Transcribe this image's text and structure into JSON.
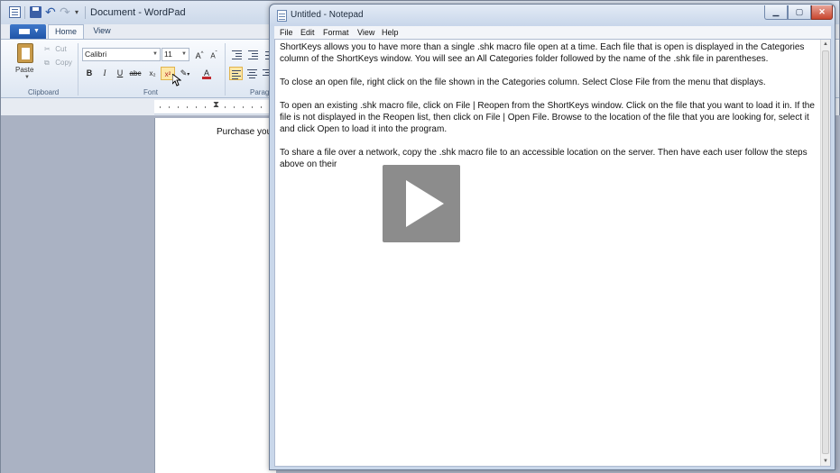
{
  "wordpad": {
    "title": "Document - WordPad",
    "tabs": [
      {
        "label": "Home"
      },
      {
        "label": "View"
      }
    ],
    "clipboard": {
      "paste": "Paste",
      "cut": "Cut",
      "copy": "Copy",
      "group_label": "Clipboard"
    },
    "font": {
      "name": "Calibri",
      "size": "11",
      "group_label": "Font",
      "bold": "B",
      "italic": "I",
      "underline": "U",
      "strike": "abc",
      "subscript": "x₂",
      "superscript": "x²"
    },
    "paragraph": {
      "group_label": "Parag"
    },
    "document_text": "Purchase you"
  },
  "notepad": {
    "title": "Untitled - Notepad",
    "menu": [
      {
        "label": "File"
      },
      {
        "label": "Edit"
      },
      {
        "label": "Format"
      },
      {
        "label": "View"
      },
      {
        "label": "Help"
      }
    ],
    "paragraphs": [
      "ShortKeys allows you to have more than a single .shk macro file open at a time. Each file that is open is displayed in the Categories column of the ShortKeys window. You will see an All Categories folder followed by the name of the .shk file in parentheses.",
      "To close an open file, right click on the file shown in the Categories column. Select Close File from the menu that displays.",
      "To open an existing .shk macro file, click on File | Reopen from the ShortKeys window. Click on the file that you want to load it in. If the file is not displayed in the Reopen list, then click on File | Open File. Browse to the location of the file that you are looking for, select it and click Open to load it into the program.",
      "To share a file over a network, copy the .shk macro file to an accessible location on the server. Then have each user follow the steps above on their"
    ]
  },
  "colors": {
    "accent": "#1f55a8",
    "close": "#c9462e"
  },
  "icons": [
    "save-icon",
    "undo-icon",
    "redo-icon",
    "paste-icon",
    "cut-icon",
    "copy-icon",
    "play-icon"
  ]
}
